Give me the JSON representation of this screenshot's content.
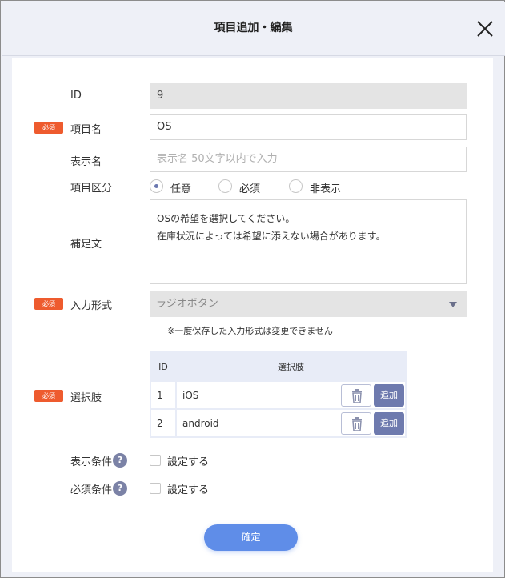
{
  "dialog": {
    "title": "項目追加・編集"
  },
  "required_badge": "必須",
  "form": {
    "id": {
      "label": "ID",
      "value": "9"
    },
    "item_name": {
      "label": "項目名",
      "value": "OS"
    },
    "display_name": {
      "label": "表示名",
      "placeholder": "表示名 50文字以内で入力"
    },
    "item_type": {
      "label": "項目区分",
      "options": [
        "任意",
        "必須",
        "非表示"
      ],
      "selected": "任意"
    },
    "supplement": {
      "label": "補足文",
      "line1": "OSの希望を選択してください。",
      "line2": "在庫状況によっては希望に添えない場合があります。"
    },
    "input_format": {
      "label": "入力形式",
      "value": "ラジオボタン",
      "note": "※一度保存した入力形式は変更できません"
    },
    "choices": {
      "label": "選択肢",
      "header_id": "ID",
      "header_choice": "選択肢",
      "add_label": "追加",
      "rows": [
        {
          "id": "1",
          "value": "iOS"
        },
        {
          "id": "2",
          "value": "android"
        }
      ]
    },
    "display_condition": {
      "label": "表示条件",
      "checkbox_label": "設定する",
      "help": "?"
    },
    "required_condition": {
      "label": "必須条件",
      "checkbox_label": "設定する",
      "help": "?"
    }
  },
  "confirm_label": "確定",
  "colors": {
    "required_badge": "#ee5b2e",
    "accent": "#6e7aae",
    "confirm_button": "#5f8de8"
  }
}
